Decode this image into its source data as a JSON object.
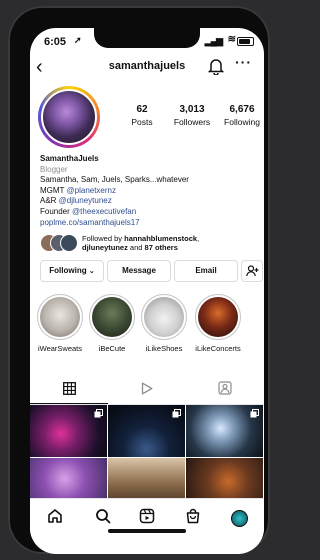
{
  "status_bar": {
    "time": "6:05",
    "location_icon": "location-arrow-icon"
  },
  "header": {
    "username": "samanthajuels"
  },
  "profile": {
    "stats": [
      {
        "value": "62",
        "label": "Posts"
      },
      {
        "value": "3,013",
        "label": "Followers"
      },
      {
        "value": "6,676",
        "label": "Following"
      }
    ],
    "bio": {
      "name": "SamanthaJuels",
      "category": "Blogger",
      "line1": "Samantha, Sam, Juels, Sparks...whatever",
      "line2_prefix": "MGMT ",
      "line2_tag": "@planetxernz",
      "line3_prefix": "A&R ",
      "line3_tag": "@djluneytunez",
      "line4_prefix": "Founder ",
      "line4_tag": "@theexecutivefan",
      "link": "poplme.co/samanthajuels17"
    },
    "followed_by": {
      "prefix": "Followed by ",
      "name1": "hannahblumenstock",
      "sep": ",",
      "name2": "djluneytunez",
      "mid": " and ",
      "others": "87 others"
    }
  },
  "actions": {
    "following_label": "Following",
    "message_label": "Message",
    "email_label": "Email"
  },
  "highlights": [
    {
      "label": "iWearSweats"
    },
    {
      "label": "iBeCute"
    },
    {
      "label": "iLikeShoes"
    },
    {
      "label": "iLikeConcerts"
    }
  ],
  "colors": {
    "link": "#2f4f8f",
    "category": "#8e8e93",
    "story_ring": [
      "#fdd200",
      "#f58529",
      "#dd2a7b",
      "#8134af",
      "#515bd4"
    ]
  },
  "tabs": [
    "grid-icon",
    "reels-icon",
    "tagged-icon"
  ],
  "nav": [
    "home-icon",
    "search-icon",
    "reels-icon",
    "shop-icon",
    "profile-avatar"
  ]
}
